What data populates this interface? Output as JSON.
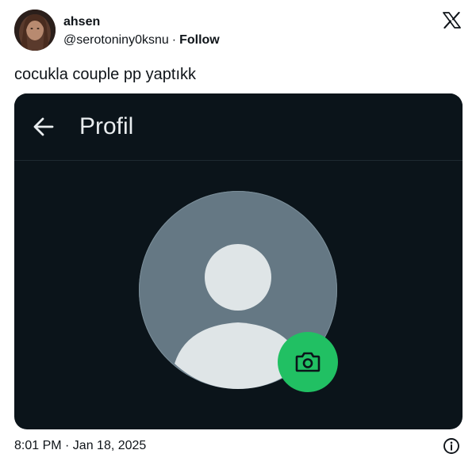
{
  "tweet": {
    "author": {
      "name": "ahsen",
      "handle": "@serotoniny0ksnu",
      "separator": "·",
      "follow_label": "Follow"
    },
    "text": "cocukla couple pp yaptıkk",
    "timestamp": "8:01 PM · Jan 18, 2025",
    "icons": {
      "brand": "x-logo-icon",
      "info": "info-icon"
    }
  },
  "screenshot": {
    "header_title": "Profil",
    "icons": {
      "back": "arrow-left-icon",
      "camera": "camera-icon",
      "avatar": "default-person-icon"
    },
    "colors": {
      "background": "#0b141a",
      "title_text": "#e9edef",
      "avatar_bg": "#657884",
      "avatar_figure": "#dfe5e7",
      "camera_button": "#21c063"
    }
  }
}
